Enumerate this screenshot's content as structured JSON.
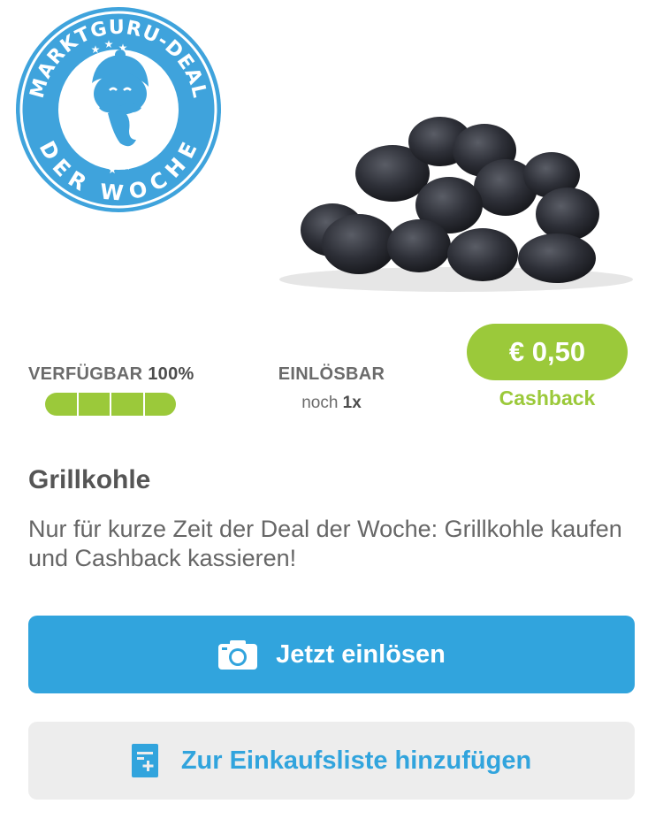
{
  "hero": {
    "badge_top_text": "MARKTGURU-DEAL",
    "badge_bottom_text": "DER WOCHE",
    "badge_color": "#3fa3dc",
    "image_icon": "charcoal-briquettes-image"
  },
  "stats": {
    "availability_label": "VERFÜGBAR",
    "availability_value": "100%",
    "availability_fraction": 1.0,
    "redeemable_label": "EINLÖSBAR",
    "redeemable_prefix": "noch",
    "redeemable_count": "1x"
  },
  "cashback": {
    "amount": "€ 0,50",
    "label": "Cashback",
    "color": "#9bc93a"
  },
  "deal": {
    "title": "Grillkohle",
    "description": "Nur für kurze Zeit der Deal der Woche: Grillkohle kaufen und Cashback kassieren!"
  },
  "actions": {
    "redeem_label": "Jetzt einlösen",
    "redeem_icon": "camera-icon",
    "add_list_label": "Zur Einkaufsliste hinzufügen",
    "add_list_icon": "shopping-list-add-icon",
    "primary_color": "#31a4dd"
  }
}
